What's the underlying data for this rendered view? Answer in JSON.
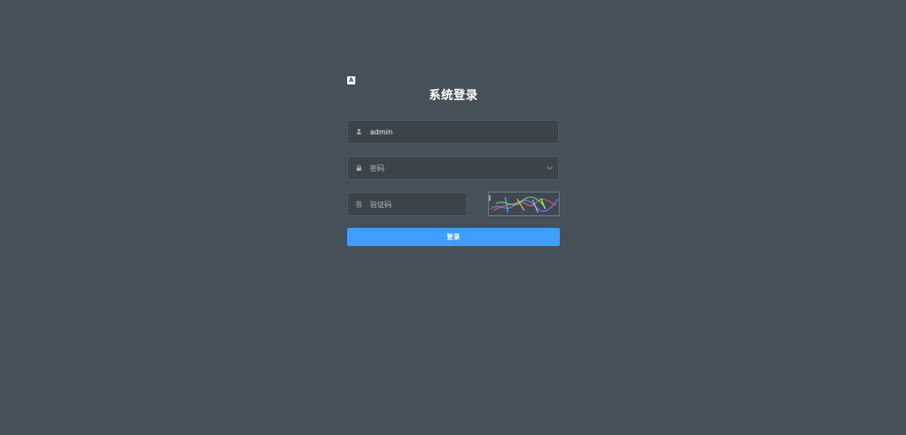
{
  "login": {
    "logo_text": "A",
    "title": "系统登录",
    "username_value": "admin",
    "password_placeholder": "密码",
    "captcha_placeholder": "验证码",
    "submit_label": "登录"
  },
  "icons": {
    "user": "user-icon",
    "lock": "lock-icon",
    "document": "document-icon",
    "chevron": "chevron-down-icon"
  },
  "colors": {
    "background": "#465058",
    "field_background": "#3b444b",
    "button_background": "#409eff",
    "button_text": "#ffffff",
    "title_text": "#ffffff"
  }
}
